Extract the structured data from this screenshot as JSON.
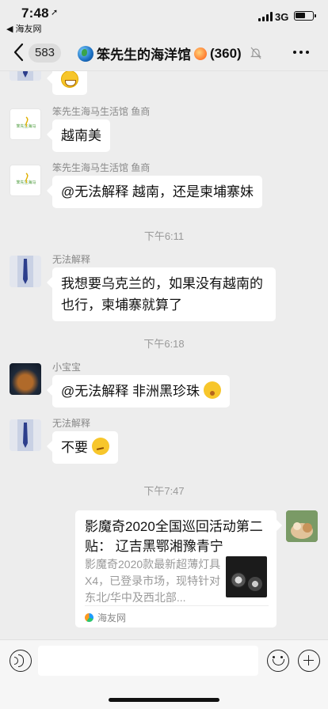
{
  "status_bar": {
    "time": "7:48",
    "location_arrow": "➚",
    "back_app": "◀ 海友网",
    "network": "3G",
    "battery_level": 0.6
  },
  "header": {
    "unread_count": "583",
    "title": "笨先生的海洋馆",
    "member_count": "(360)",
    "icons": [
      "back-chevron-icon",
      "globe-icon",
      "fishball-icon",
      "mute-bell-icon",
      "more-icon"
    ]
  },
  "messages": {
    "m1": {
      "emoji": "grin"
    },
    "m2": {
      "sender": "笨先生海马生活馆 鱼商",
      "text": "越南美"
    },
    "m3": {
      "sender": "笨先生海马生活馆 鱼商",
      "text": "@无法解释 越南，还是柬埔寨妹"
    },
    "ts1": "下午6:11",
    "m4": {
      "sender": "无法解释",
      "line1": "我想要乌克兰的，如果没有越南的",
      "line2": "也行，柬埔寨就算了"
    },
    "ts2": "下午6:18",
    "m5": {
      "sender": "小宝宝",
      "text": "@无法解释 非洲黑珍珠"
    },
    "m6": {
      "sender": "无法解释",
      "text": "不要"
    },
    "ts3": "下午7:47",
    "card": {
      "title": "影魔奇2020全国巡回活动第二贴： 辽吉黑鄂湘豫青宁",
      "description": "影魔奇2020款最新超薄灯具X4，已登录市场，现特针对东北/华中及西北部...",
      "source": "海友网"
    }
  },
  "input_bar": {
    "icons": [
      "voice-icon",
      "emoji-icon",
      "plus-icon"
    ]
  }
}
